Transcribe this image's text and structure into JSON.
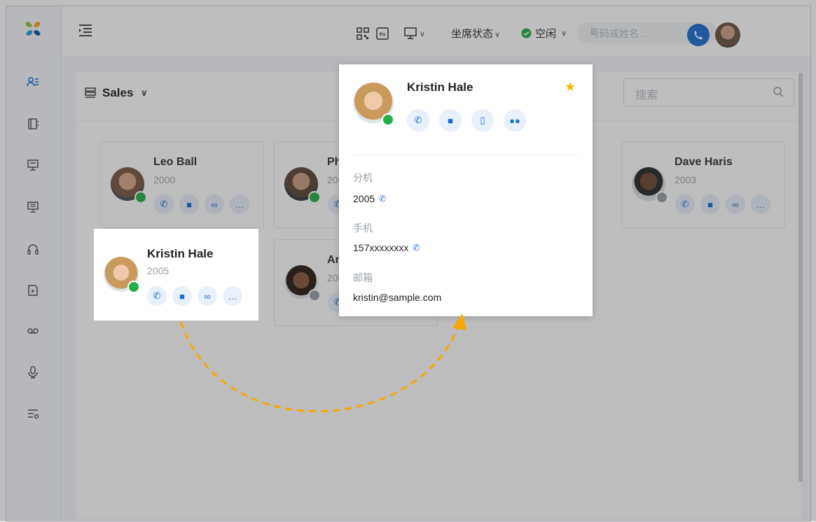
{
  "topbar": {
    "agent_status_label": "坐席状态",
    "presence_label": "空闲",
    "search_placeholder": "号码或姓名..."
  },
  "contacts": {
    "group_name": "Sales",
    "search_placeholder": "搜索",
    "cards": [
      {
        "name": "Leo Ball",
        "ext": "2000",
        "status": "available"
      },
      {
        "name": "Phi",
        "ext": "200",
        "status": "available"
      },
      {
        "name": "Dave Haris",
        "ext": "2003",
        "status": "offline"
      },
      {
        "name": "Ann",
        "ext": "200",
        "status": "offline"
      }
    ],
    "highlighted": {
      "name": "Kristin Hale",
      "ext": "2005",
      "status": "available"
    }
  },
  "popup": {
    "name": "Kristin Hale",
    "favorite": true,
    "extension_label": "分机",
    "extension_value": "2005",
    "mobile_label": "手机",
    "mobile_value": "157xxxxxxxx",
    "email_label": "邮箱",
    "email_value": "kristin@sample.com"
  },
  "colors": {
    "accent": "#1e6fd0",
    "available": "#23b04b",
    "favorite": "#f5b800",
    "arrow": "#f5a800"
  }
}
